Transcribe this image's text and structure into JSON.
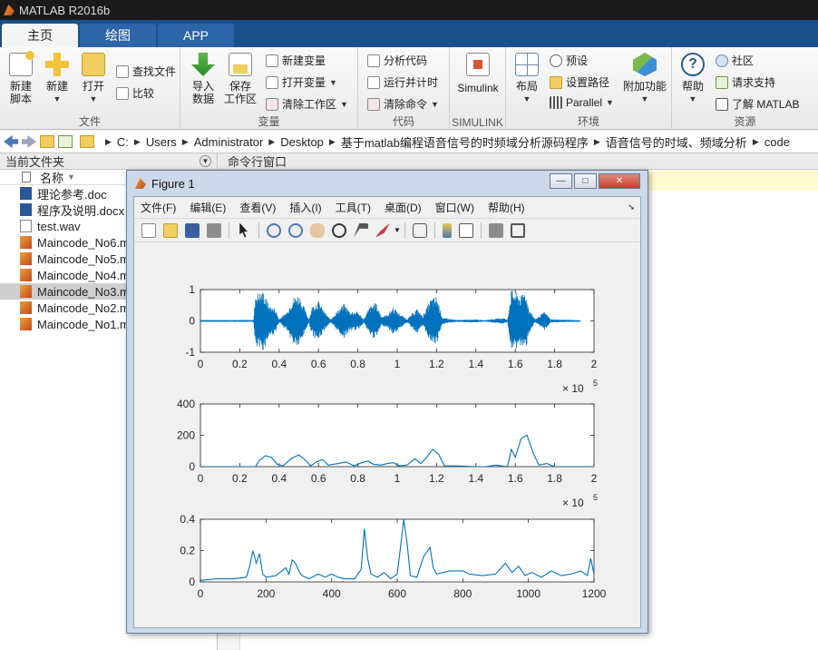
{
  "app": {
    "title": "MATLAB R2016b"
  },
  "tabs": [
    {
      "label": "主页"
    },
    {
      "label": "绘图"
    },
    {
      "label": "APP"
    }
  ],
  "ribbon": {
    "file": {
      "title": "文件",
      "new_script": "新建\n脚本",
      "new": "新建",
      "open": "打开",
      "find_files": "查找文件",
      "compare": "比较"
    },
    "variable": {
      "title": "变量",
      "import": "导入\n数据",
      "save_workspace": "保存\n工作区",
      "new_variable": "新建变量",
      "open_variable": "打开变量",
      "clear_workspace": "清除工作区"
    },
    "code": {
      "title": "代码",
      "analyze": "分析代码",
      "run_time": "运行并计时",
      "clear_commands": "清除命令"
    },
    "simulink": {
      "title": "SIMULINK",
      "label": "Simulink"
    },
    "environment": {
      "title": "环境",
      "layout": "布局",
      "preferences": "预设",
      "set_path": "设置路径",
      "parallel": "Parallel",
      "addons": "附加功能"
    },
    "resources": {
      "title": "资源",
      "help": "帮助",
      "community": "社区",
      "support": "请求支持",
      "learn": "了解 MATLAB"
    }
  },
  "address": {
    "path": [
      "C:",
      "Users",
      "Administrator",
      "Desktop",
      "基于matlab编程语音信号的时频域分析源码程序",
      "语音信号的时域、频域分析",
      "code"
    ]
  },
  "current_folder": {
    "title": "当前文件夹",
    "column_name": "名称",
    "files": [
      {
        "name": "理论参考.doc",
        "type": "word"
      },
      {
        "name": "程序及说明.docx",
        "type": "word"
      },
      {
        "name": "test.wav",
        "type": "wav"
      },
      {
        "name": "Maincode_No6.m",
        "type": "m"
      },
      {
        "name": "Maincode_No5.m",
        "type": "m"
      },
      {
        "name": "Maincode_No4.m",
        "type": "m"
      },
      {
        "name": "Maincode_No3.m",
        "type": "m",
        "selected": true
      },
      {
        "name": "Maincode_No2.m",
        "type": "m"
      },
      {
        "name": "Maincode_No1.m",
        "type": "m"
      }
    ]
  },
  "command_window": {
    "title": "命令行窗口"
  },
  "figure": {
    "title": "Figure 1",
    "menu": [
      "文件(F)",
      "编辑(E)",
      "查看(V)",
      "插入(I)",
      "工具(T)",
      "桌面(D)",
      "窗口(W)",
      "帮助(H)"
    ],
    "toolbar_icons": [
      "new-figure-icon",
      "open-icon",
      "save-icon",
      "print-icon",
      "pointer-icon",
      "zoom-in-icon",
      "zoom-out-icon",
      "pan-icon",
      "rotate-icon",
      "data-cursor-icon",
      "brush-icon",
      "link-icon",
      "colorbar-icon",
      "legend-icon",
      "hide-plot-tools-icon",
      "show-plot-tools-icon"
    ]
  },
  "chart_data": [
    {
      "type": "line",
      "color": "#0072bd",
      "xlim": [
        0,
        200000
      ],
      "ylim": [
        -1,
        1
      ],
      "xticks": [
        "0",
        "0.2",
        "0.4",
        "0.6",
        "0.8",
        "1",
        "1.2",
        "1.4",
        "1.6",
        "1.8",
        "2"
      ],
      "yticks": [
        "1",
        "0",
        "-1"
      ],
      "exponent": "× 10",
      "exponent_power": "5",
      "envelope": [
        [
          0,
          0.01
        ],
        [
          27000,
          0.01
        ],
        [
          28000,
          0.9
        ],
        [
          32000,
          0.95
        ],
        [
          35000,
          0.5
        ],
        [
          38000,
          0.4
        ],
        [
          40000,
          0.05
        ],
        [
          44000,
          0.3
        ],
        [
          47000,
          0.75
        ],
        [
          50000,
          0.85
        ],
        [
          53000,
          0.4
        ],
        [
          55000,
          0.05
        ],
        [
          57000,
          0.5
        ],
        [
          60000,
          0.65
        ],
        [
          63000,
          0.3
        ],
        [
          66000,
          0.05
        ],
        [
          70000,
          0.35
        ],
        [
          73000,
          0.55
        ],
        [
          76000,
          0.3
        ],
        [
          80000,
          0.3
        ],
        [
          83000,
          0.05
        ],
        [
          86000,
          0.45
        ],
        [
          89000,
          0.6
        ],
        [
          92000,
          0.15
        ],
        [
          95000,
          0.2
        ],
        [
          98000,
          0.45
        ],
        [
          101000,
          0.25
        ],
        [
          105000,
          0.05
        ],
        [
          110000,
          0.4
        ],
        [
          113000,
          0.15
        ],
        [
          117000,
          0.7
        ],
        [
          120000,
          0.8
        ],
        [
          123000,
          0.1
        ],
        [
          130000,
          0.03
        ],
        [
          140000,
          0.05
        ],
        [
          144000,
          0.02
        ],
        [
          154000,
          0.1
        ],
        [
          156000,
          0.02
        ],
        [
          158000,
          1
        ],
        [
          163000,
          0.8
        ],
        [
          165000,
          1
        ],
        [
          167000,
          0.4
        ],
        [
          170000,
          0.05
        ],
        [
          175000,
          0.3
        ],
        [
          178000,
          0.05
        ],
        [
          200000,
          0.01
        ]
      ]
    },
    {
      "type": "line",
      "color": "#0072bd",
      "xlim": [
        0,
        200000
      ],
      "ylim": [
        0,
        400
      ],
      "xticks": [
        "0",
        "0.2",
        "0.4",
        "0.6",
        "0.8",
        "1",
        "1.2",
        "1.4",
        "1.6",
        "1.8",
        "2"
      ],
      "yticks": [
        "400",
        "200",
        "0"
      ],
      "exponent": "× 10",
      "exponent_power": "5",
      "points": [
        [
          0,
          0
        ],
        [
          28000,
          0
        ],
        [
          30000,
          40
        ],
        [
          33000,
          70
        ],
        [
          36000,
          60
        ],
        [
          39000,
          15
        ],
        [
          42000,
          5
        ],
        [
          46000,
          50
        ],
        [
          50000,
          75
        ],
        [
          53000,
          45
        ],
        [
          56000,
          5
        ],
        [
          59000,
          30
        ],
        [
          62000,
          45
        ],
        [
          65000,
          10
        ],
        [
          70000,
          20
        ],
        [
          74000,
          30
        ],
        [
          78000,
          5
        ],
        [
          82000,
          25
        ],
        [
          85000,
          35
        ],
        [
          88000,
          15
        ],
        [
          92000,
          10
        ],
        [
          95000,
          20
        ],
        [
          98000,
          25
        ],
        [
          101000,
          5
        ],
        [
          105000,
          10
        ],
        [
          109000,
          50
        ],
        [
          112000,
          20
        ],
        [
          115000,
          60
        ],
        [
          118000,
          110
        ],
        [
          121000,
          80
        ],
        [
          124000,
          5
        ],
        [
          130000,
          5
        ],
        [
          140000,
          0
        ],
        [
          145000,
          0
        ],
        [
          150000,
          10
        ],
        [
          156000,
          0
        ],
        [
          158000,
          110
        ],
        [
          160000,
          60
        ],
        [
          163000,
          180
        ],
        [
          166000,
          200
        ],
        [
          169000,
          90
        ],
        [
          172000,
          10
        ],
        [
          176000,
          20
        ],
        [
          180000,
          0
        ],
        [
          200000,
          0
        ]
      ]
    },
    {
      "type": "line",
      "color": "#0072bd",
      "xlim": [
        0,
        1200
      ],
      "ylim": [
        0,
        0.4
      ],
      "xticks": [
        "0",
        "200",
        "400",
        "600",
        "800",
        "1000",
        "1200"
      ],
      "yticks": [
        "0.4",
        "0.2",
        "0"
      ],
      "points": [
        [
          0,
          0.01
        ],
        [
          50,
          0.02
        ],
        [
          100,
          0.02
        ],
        [
          140,
          0.03
        ],
        [
          150,
          0.1
        ],
        [
          160,
          0.2
        ],
        [
          170,
          0.12
        ],
        [
          180,
          0.18
        ],
        [
          190,
          0.05
        ],
        [
          200,
          0.03
        ],
        [
          230,
          0.04
        ],
        [
          260,
          0.09
        ],
        [
          270,
          0.05
        ],
        [
          280,
          0.14
        ],
        [
          290,
          0.12
        ],
        [
          300,
          0.07
        ],
        [
          310,
          0.04
        ],
        [
          330,
          0.02
        ],
        [
          360,
          0.05
        ],
        [
          380,
          0.03
        ],
        [
          400,
          0.05
        ],
        [
          420,
          0.03
        ],
        [
          440,
          0.02
        ],
        [
          470,
          0.02
        ],
        [
          490,
          0.08
        ],
        [
          500,
          0.34
        ],
        [
          510,
          0.15
        ],
        [
          520,
          0.05
        ],
        [
          540,
          0.03
        ],
        [
          560,
          0.06
        ],
        [
          580,
          0.02
        ],
        [
          600,
          0.05
        ],
        [
          610,
          0.22
        ],
        [
          620,
          0.4
        ],
        [
          630,
          0.25
        ],
        [
          640,
          0.04
        ],
        [
          660,
          0.03
        ],
        [
          680,
          0.16
        ],
        [
          700,
          0.22
        ],
        [
          710,
          0.09
        ],
        [
          720,
          0.05
        ],
        [
          740,
          0.06
        ],
        [
          760,
          0.07
        ],
        [
          800,
          0.07
        ],
        [
          820,
          0.05
        ],
        [
          860,
          0.04
        ],
        [
          900,
          0.05
        ],
        [
          930,
          0.12
        ],
        [
          950,
          0.06
        ],
        [
          970,
          0.1
        ],
        [
          990,
          0.04
        ],
        [
          1010,
          0.06
        ],
        [
          1040,
          0.03
        ],
        [
          1070,
          0.07
        ],
        [
          1100,
          0.04
        ],
        [
          1130,
          0.05
        ],
        [
          1160,
          0.07
        ],
        [
          1180,
          0.04
        ],
        [
          1190,
          0.15
        ],
        [
          1200,
          0.05
        ]
      ]
    }
  ]
}
